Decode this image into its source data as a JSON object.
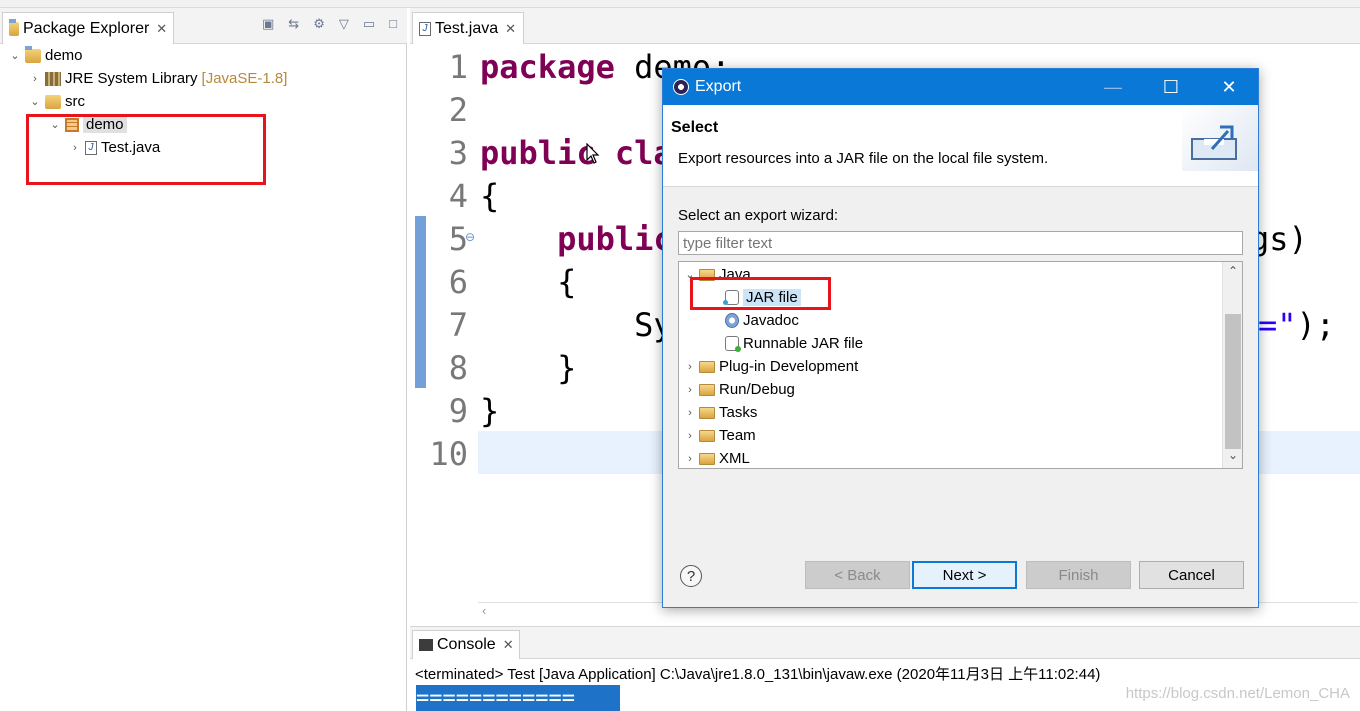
{
  "package_explorer": {
    "tab_title": "Package Explorer",
    "close_glyph": "✕",
    "tree": [
      {
        "label": "demo",
        "extra": ""
      },
      {
        "label": "JRE System Library",
        "extra": "[JavaSE-1.8]"
      },
      {
        "label": "src",
        "extra": ""
      },
      {
        "label": "demo",
        "extra": ""
      },
      {
        "label": "Test.java",
        "extra": ""
      }
    ]
  },
  "editor": {
    "tab_title": "Test.java",
    "lines": [
      {
        "n": "1",
        "a": "package",
        "b": " demo;"
      },
      {
        "n": "2",
        "a": "",
        "b": ""
      },
      {
        "n": "3",
        "a": "public",
        "b": " cla"
      },
      {
        "n": "4",
        "a": "",
        "b": "{"
      },
      {
        "n": "5",
        "a": "    public",
        "b": ""
      },
      {
        "n": "6",
        "a": "",
        "b": "    {"
      },
      {
        "n": "7",
        "a": "",
        "b": "        Sy"
      },
      {
        "n": "8",
        "a": "",
        "b": "    }"
      },
      {
        "n": "9",
        "a": "",
        "b": "}"
      },
      {
        "n": "10",
        "a": "",
        "b": ""
      }
    ],
    "overflow_right": {
      "line5": "gs)",
      "line7_str": "=\"",
      "line7_tail": ");"
    }
  },
  "console": {
    "tab_title": "Console",
    "status": "<terminated> Test [Java Application] C:\\Java\\jre1.8.0_131\\bin\\javaw.exe (2020年11月3日 上午11:02:44)",
    "output": "============",
    "watermark": "https://blog.csdn.net/Lemon_CHA"
  },
  "dialog": {
    "title": "Export",
    "header_title": "Select",
    "header_desc": "Export resources into a JAR file on the local file system.",
    "select_label": "Select an export wizard:",
    "filter_placeholder": "type filter text",
    "items": [
      {
        "label": "Java",
        "kind": "folder"
      },
      {
        "label": "JAR file",
        "kind": "jar"
      },
      {
        "label": "Javadoc",
        "kind": "doc"
      },
      {
        "label": "Runnable JAR file",
        "kind": "run"
      },
      {
        "label": "Plug-in Development",
        "kind": "folder"
      },
      {
        "label": "Run/Debug",
        "kind": "folder"
      },
      {
        "label": "Tasks",
        "kind": "folder"
      },
      {
        "label": "Team",
        "kind": "folder"
      },
      {
        "label": "XML",
        "kind": "folder"
      }
    ],
    "buttons": {
      "help": "?",
      "back": "< Back",
      "next": "Next >",
      "finish": "Finish",
      "cancel": "Cancel"
    },
    "window": {
      "minimize": "—",
      "maximize": "☐",
      "close": "✕"
    }
  },
  "colors": {
    "keyword": "#7f0055",
    "string": "#2a00ff",
    "accent": "#0a78d7",
    "highlight_box": "#e8141b"
  }
}
